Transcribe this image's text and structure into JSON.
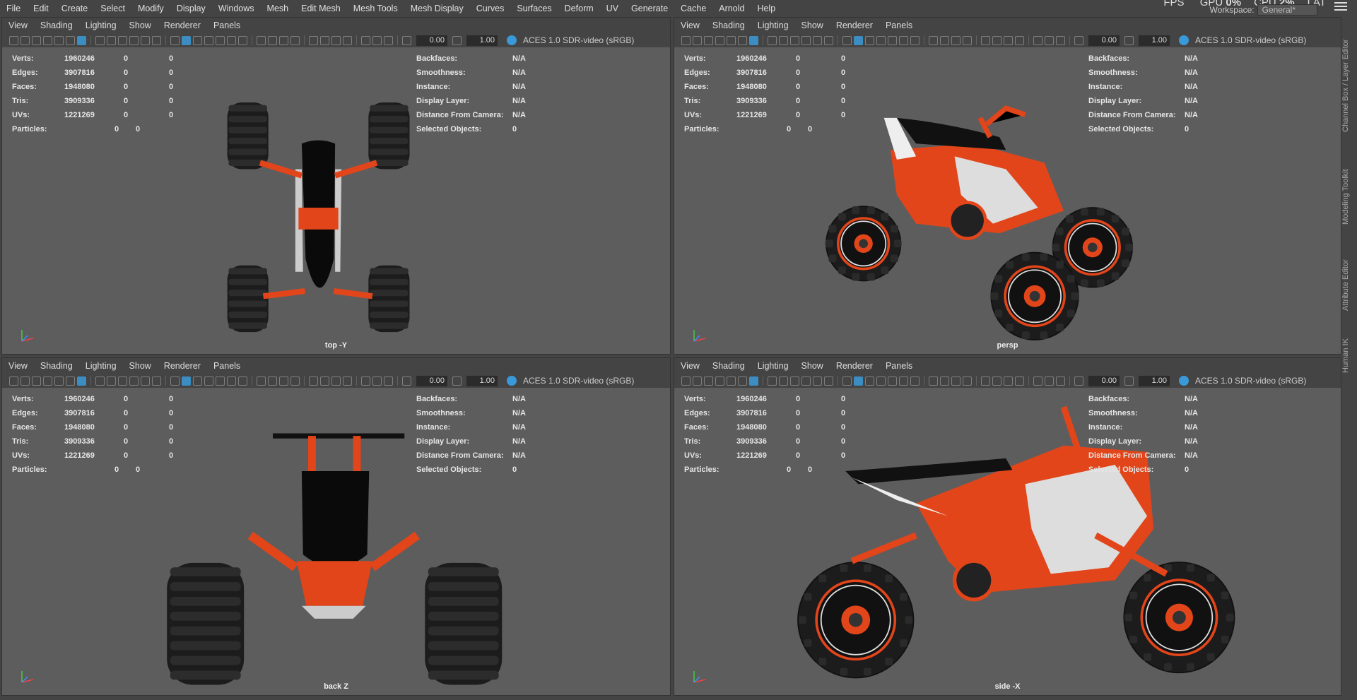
{
  "menubar": {
    "items": [
      "File",
      "Edit",
      "Create",
      "Select",
      "Modify",
      "Display",
      "Windows",
      "Mesh",
      "Edit Mesh",
      "Mesh Tools",
      "Mesh Display",
      "Curves",
      "Surfaces",
      "Deform",
      "UV",
      "Generate",
      "Cache",
      "Arnold",
      "Help"
    ]
  },
  "hud": {
    "fps_label": "FPS",
    "gpu_label": "GPU",
    "gpu_value": "0%",
    "cpu_label": "CPU",
    "cpu_value": "2%",
    "lat_label": "LAT"
  },
  "workspace": {
    "label": "Workspace:",
    "value": "General*"
  },
  "right_tabs": [
    "Channel Box / Layer Editor",
    "Modeling Toolkit",
    "Attribute Editor",
    "Human IK"
  ],
  "panel_menu": [
    "View",
    "Shading",
    "Lighting",
    "Show",
    "Renderer",
    "Panels"
  ],
  "toolbar": {
    "field1": "0.00",
    "field2": "1.00",
    "colorspace": "ACES 1.0 SDR-video (sRGB)"
  },
  "stats": [
    {
      "label": "Verts:",
      "v1": "1960246",
      "v2": "0",
      "v3": "0"
    },
    {
      "label": "Edges:",
      "v1": "3907816",
      "v2": "0",
      "v3": "0"
    },
    {
      "label": "Faces:",
      "v1": "1948080",
      "v2": "0",
      "v3": "0"
    },
    {
      "label": "Tris:",
      "v1": "3909336",
      "v2": "0",
      "v3": "0"
    },
    {
      "label": "UVs:",
      "v1": "1221269",
      "v2": "0",
      "v3": "0"
    }
  ],
  "particles": {
    "label": "Particles:",
    "v1": "0",
    "v2": "0"
  },
  "stats_right": [
    {
      "label": "Backfaces:",
      "value": "N/A"
    },
    {
      "label": "Smoothness:",
      "value": "N/A"
    },
    {
      "label": "Instance:",
      "value": "N/A"
    },
    {
      "label": "Display Layer:",
      "value": "N/A"
    },
    {
      "label": "Distance From Camera:",
      "value": "N/A"
    },
    {
      "label": "Selected Objects:",
      "value": "0"
    }
  ],
  "viewports": [
    {
      "camera": "top -Y"
    },
    {
      "camera": "persp"
    },
    {
      "camera": "back Z"
    },
    {
      "camera": "side -X"
    }
  ],
  "colors": {
    "accent": "#3a9ad9",
    "body_orange": "#e2451a",
    "tire": "#222222",
    "viewport_bg": "#5d5d5d"
  }
}
